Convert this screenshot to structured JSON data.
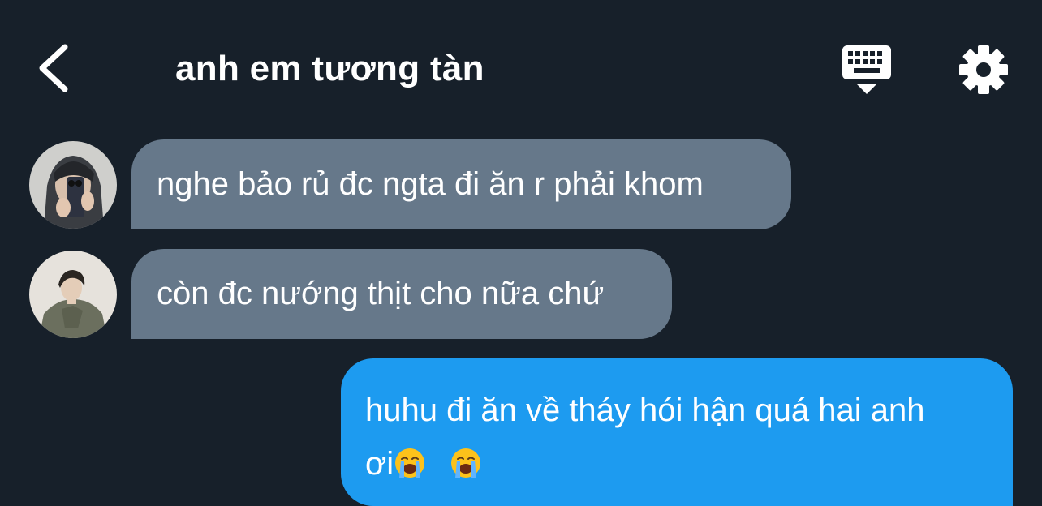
{
  "header": {
    "title": "anh em tương tàn",
    "back_icon": "chevron-left-icon",
    "keyboard_icon": "keyboard-icon",
    "settings_icon": "gear-icon"
  },
  "messages": [
    {
      "direction": "incoming",
      "text": "nghe bảo rủ đc ngta đi ăn r phải khom"
    },
    {
      "direction": "incoming",
      "text": "còn đc nướng thịt cho nữa chứ"
    },
    {
      "direction": "outgoing",
      "text_line1": "huhu đi ăn về tháy hói hận quá hai anh",
      "text_line2": "ơi",
      "emoji": "loudly-crying-face"
    }
  ],
  "colors": {
    "background": "#17202a",
    "incoming_bubble": "#66788a",
    "outgoing_bubble": "#1d9bf0",
    "text": "#ffffff"
  }
}
